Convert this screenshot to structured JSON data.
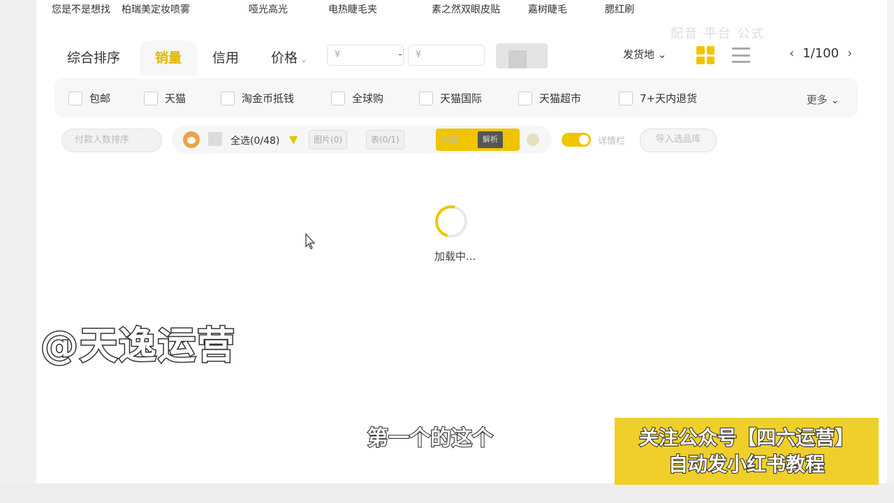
{
  "suggestions": [
    "您是不是想找",
    "柏瑞美定妆喷雾",
    "哑光高光",
    "电热睫毛夹",
    "素之然双眼皮贴",
    "嘉树睫毛",
    "腮红刷"
  ],
  "top_watermark": "配音 平台 公式",
  "sort_tabs": {
    "comprehensive": "综合排序",
    "sales": "销量",
    "credit": "信用",
    "price": "价格"
  },
  "price_filter": {
    "min_placeholder": "¥",
    "max_placeholder": "¥",
    "dash": "-"
  },
  "ship_from": "发货地",
  "pager": {
    "prev": "‹",
    "page": "1/100",
    "next": "›"
  },
  "filters": [
    "包邮",
    "天猫",
    "淘金币抵钱",
    "全球购",
    "天猫国际",
    "天猫超市",
    "7+天内退货"
  ],
  "more_label": "更多",
  "toolbar": {
    "left_pill": "付款人数排序",
    "select_all": "全选(0/48)",
    "seg1": "图片(0)",
    "seg2": "表(0/1)",
    "yellow_label": "采集",
    "dark_label": "解析",
    "toggle_label": "详情栏",
    "import_label": "导入选品库"
  },
  "loading": {
    "text": "加载中..."
  },
  "brand_watermark": "@天逸运营",
  "subtitle": "第一个的这个",
  "promo": {
    "line1": "关注公众号【四六运营】",
    "line2": "自动发小红书教程"
  },
  "colors": {
    "accent": "#f0c400",
    "promo_bg": "#f0cf2a"
  }
}
